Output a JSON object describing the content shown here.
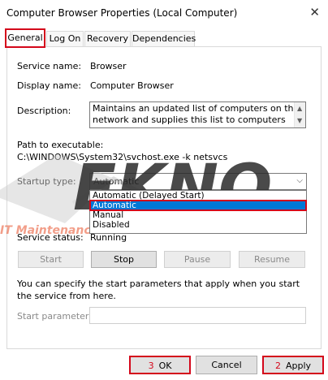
{
  "window": {
    "title": "Computer Browser Properties (Local Computer)",
    "close_icon": "close-icon"
  },
  "tabs": [
    "General",
    "Log On",
    "Recovery",
    "Dependencies"
  ],
  "general": {
    "service_name_label": "Service name:",
    "service_name": "Browser",
    "display_name_label": "Display name:",
    "display_name": "Computer Browser",
    "description_label": "Description:",
    "description": "Maintains an updated list of computers on the network and supplies this list to computers",
    "path_label": "Path to executable:",
    "path": "C:\\WINDOWS\\System32\\svchost.exe -k netsvcs",
    "startup_type_label": "Startup type:",
    "startup_type_value": "Automatic",
    "startup_options": [
      "Automatic (Delayed Start)",
      "Automatic",
      "Manual",
      "Disabled"
    ],
    "service_status_label": "Service status:",
    "service_status": "Running",
    "buttons": {
      "start": "Start",
      "stop": "Stop",
      "pause": "Pause",
      "resume": "Resume"
    },
    "help_text": "You can specify the start parameters that apply when you start the service from here.",
    "start_params_label": "Start parameters:"
  },
  "footer": {
    "ok_step": "3",
    "ok": "OK",
    "cancel": "Cancel",
    "apply_step": "2",
    "apply": "Apply"
  },
  "watermark": {
    "logo": "EKNO",
    "tagline": "IT Maintenance - CCTV - Pembuatan Website"
  },
  "colors": {
    "highlight": "#d4071b",
    "selection": "#0078d7"
  }
}
